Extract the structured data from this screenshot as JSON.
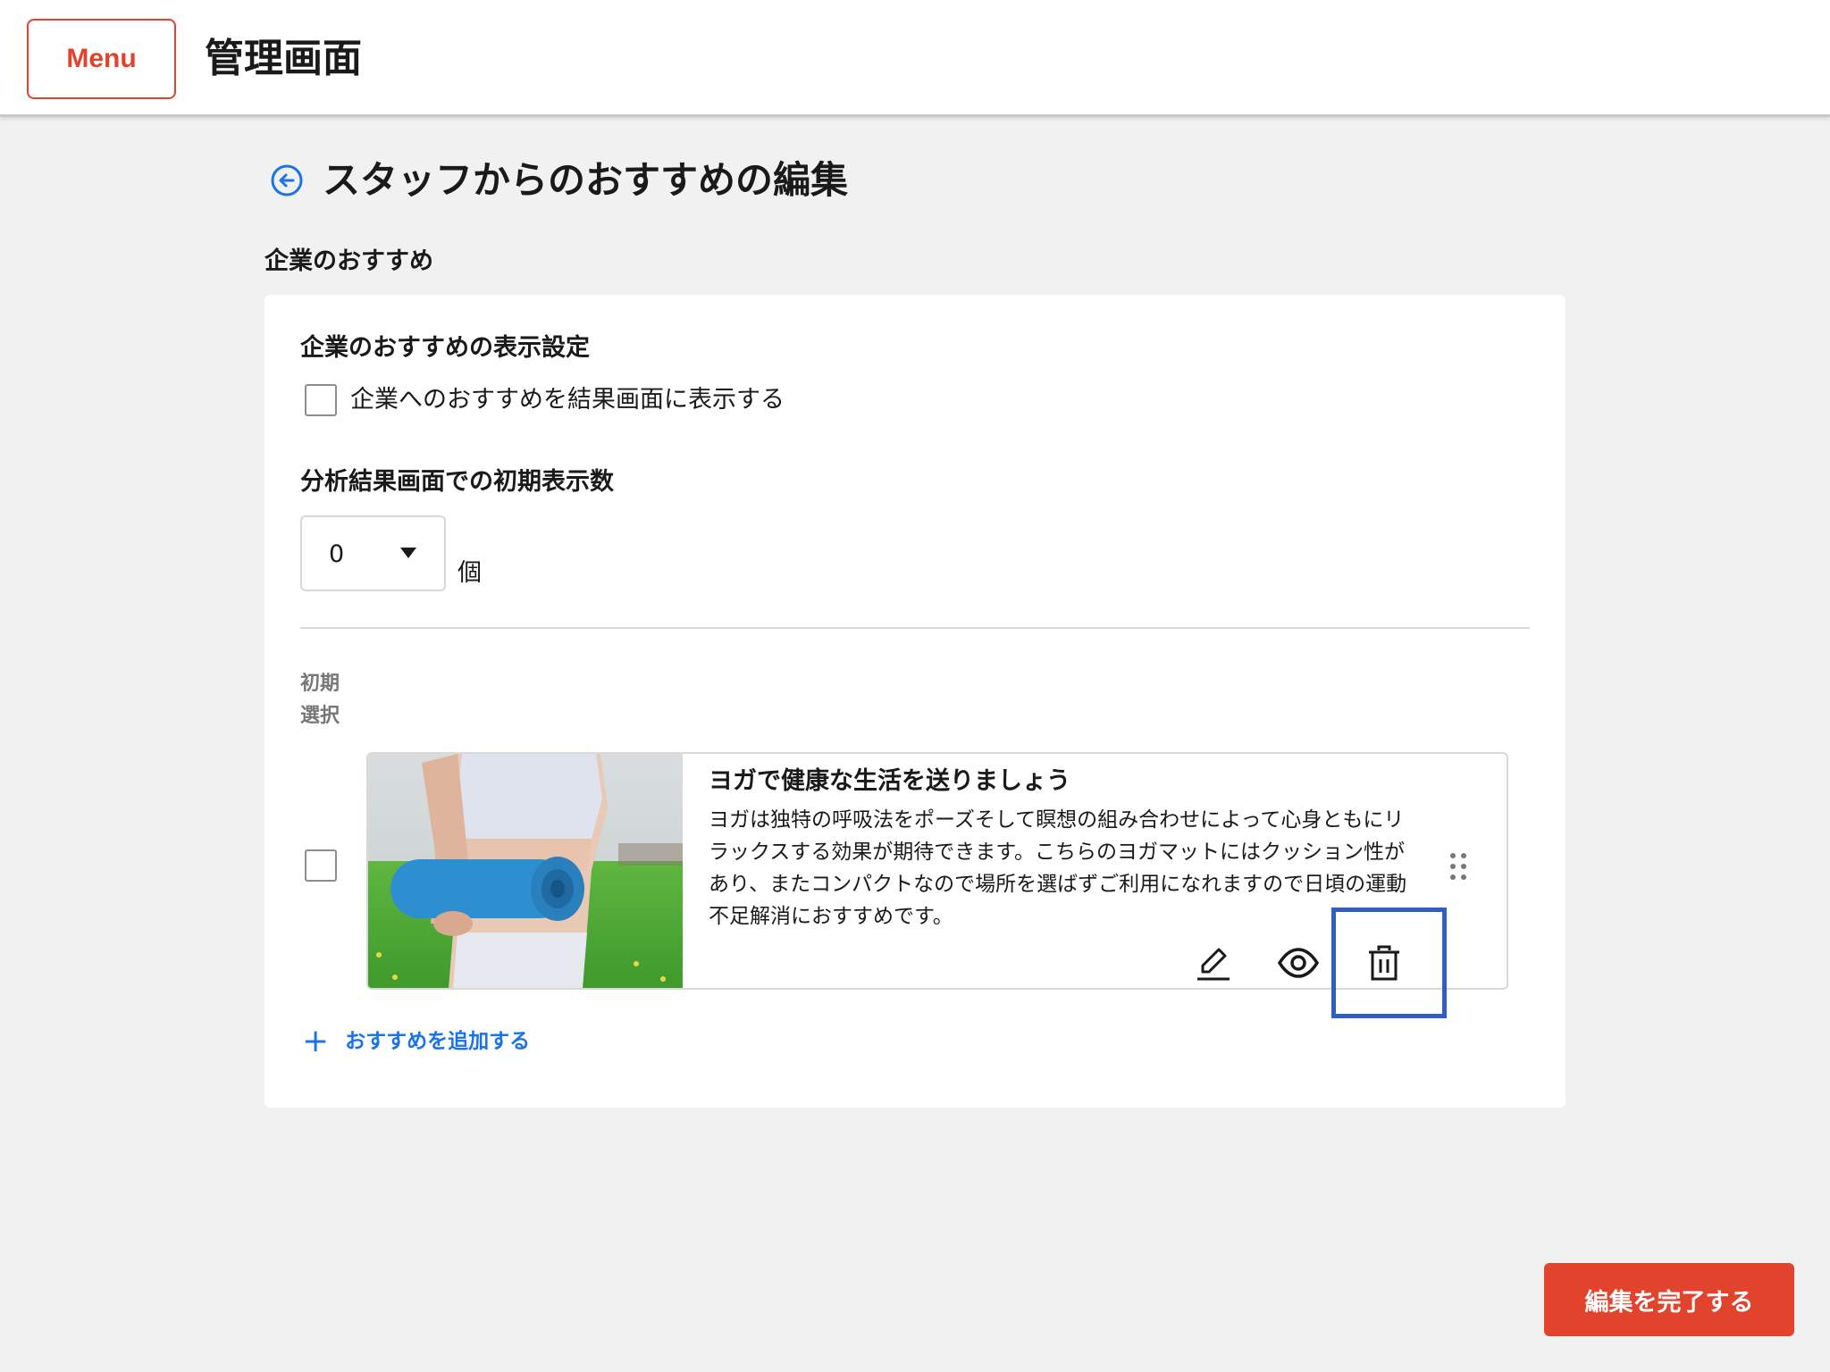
{
  "header": {
    "menu_label": "Menu",
    "app_title": "管理画面"
  },
  "page": {
    "title": "スタッフからのおすすめの編集",
    "section_title": "企業のおすすめ"
  },
  "display_settings": {
    "heading": "企業のおすすめの表示設定",
    "checkbox_label": "企業へのおすすめを結果画面に表示する",
    "checked": false
  },
  "initial_count": {
    "heading": "分析結果画面での初期表示数",
    "selected_value": "0",
    "unit": "個"
  },
  "list": {
    "column_header": "初期\n選択",
    "items": [
      {
        "title": "ヨガで健康な生活を送りましょう",
        "description": "ヨガは独特の呼吸法をポーズそして瞑想の組み合わせによって心身ともにリラックスする効果が期待できます。こちらのヨガマットにはクッション性があり、またコンパクトなので場所を選ばずご利用になれますので日頃の運動不足解消におすすめです。",
        "selected": false
      }
    ]
  },
  "add_link_label": "おすすめを追加する",
  "done_button_label": "編集を完了する",
  "icons": [
    "back-arrow-icon",
    "pencil-icon",
    "eye-icon",
    "trash-icon",
    "drag-handle-icon",
    "plus-icon"
  ],
  "colors": {
    "accent_red": "#e2432d",
    "link_blue": "#1a73e8",
    "highlight_blue": "#2f5fc4"
  }
}
